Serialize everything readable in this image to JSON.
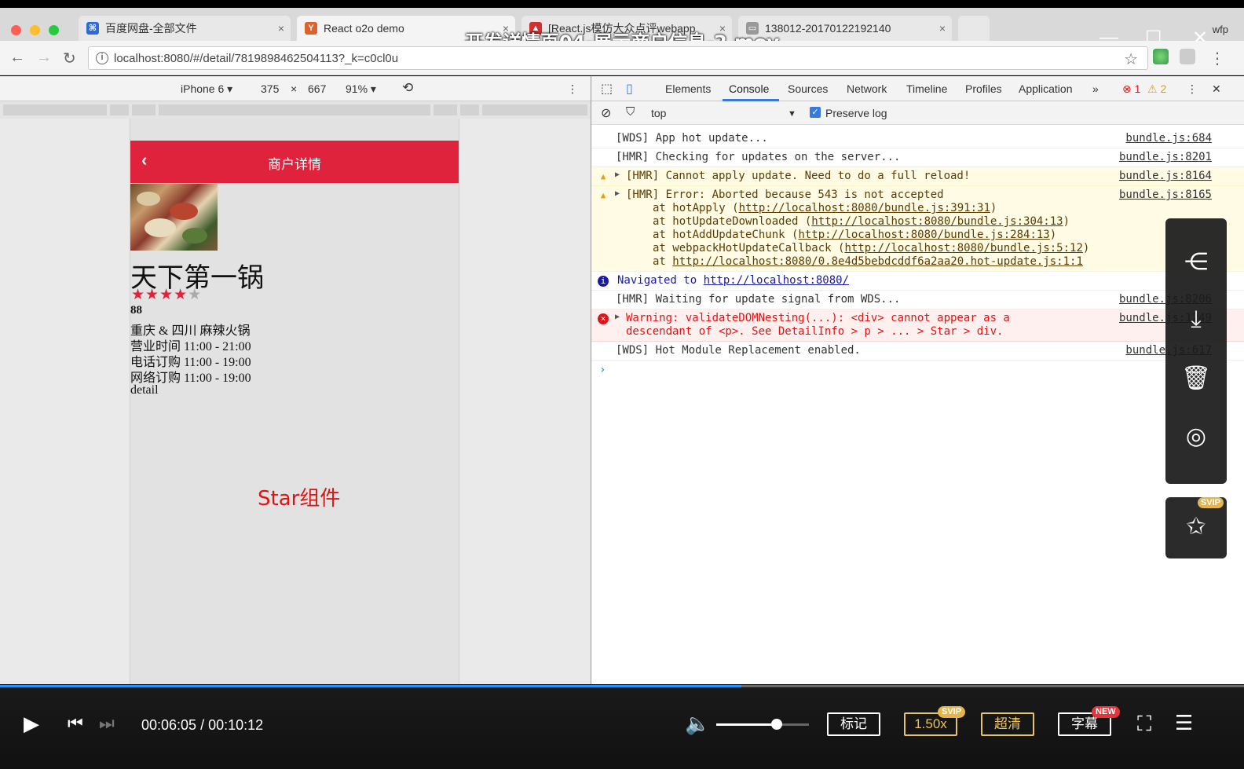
{
  "video_title": "开发详情页04-展示商户信息-2.mov",
  "browser": {
    "tabs": [
      {
        "label": "百度网盘-全部文件",
        "icon": "baidu-icon",
        "active": false
      },
      {
        "label": "React o2o demo",
        "icon": "ycombinator-icon",
        "active": true
      },
      {
        "label": "[React.js模仿大众点评webapp",
        "icon": "flame-icon",
        "active": false
      },
      {
        "label": "138012-20170122192140",
        "icon": "page-icon",
        "active": false
      }
    ],
    "user": "wfp",
    "url": "localhost:8080/#/detail/7819898462504113?_k=c0cl0u"
  },
  "device_toolbar": {
    "device": "iPhone 6",
    "width": "375",
    "times": "×",
    "height": "667",
    "zoom": "91%"
  },
  "phone": {
    "header_title": "商户详情",
    "back": "‹",
    "shop_name": "天下第一锅",
    "rating_stars": 4,
    "rating_max": 5,
    "score": "88",
    "lines": [
      "重庆 & 四川 麻辣火锅",
      "营业时间 11:00 - 21:00",
      "电话订购 11:00 - 19:00",
      "网络订购 11:00 - 19:00",
      "detail"
    ],
    "annotation": "Star组件"
  },
  "devtools": {
    "tabs": [
      "Elements",
      "Console",
      "Sources",
      "Network",
      "Timeline",
      "Profiles",
      "Application"
    ],
    "more": "»",
    "error_count": "1",
    "warning_count": "2",
    "filter_context": "top",
    "preserve_log": "Preserve log",
    "console": [
      {
        "text": "[WDS] App hot update...",
        "src": "bundle.js:684"
      },
      {
        "text": "[HMR] Checking for updates on the server...",
        "src": "bundle.js:8201"
      },
      {
        "text": "[HMR] Cannot apply update. Need to do a full reload!",
        "src": "bundle.js:8164"
      },
      {
        "text": "[HMR] Error: Aborted because 543 is not accepted",
        "src": "bundle.js:8165",
        "trace": [
          {
            "prefix": "at hotApply (",
            "link": "http://localhost:8080/bundle.js:391:31",
            "suffix": ")"
          },
          {
            "prefix": "at hotUpdateDownloaded (",
            "link": "http://localhost:8080/bundle.js:304:13",
            "suffix": ")"
          },
          {
            "prefix": "at hotAddUpdateChunk (",
            "link": "http://localhost:8080/bundle.js:284:13",
            "suffix": ")"
          },
          {
            "prefix": "at webpackHotUpdateCallback (",
            "link": "http://localhost:8080/bundle.js:5:12",
            "suffix": ")"
          },
          {
            "prefix": "at ",
            "link": "http://localhost:8080/0.8e4d5bebdcddf6a2aa20.hot-update.js:1:1",
            "suffix": ""
          }
        ]
      },
      {
        "text": "Navigated to",
        "link": "http://localhost:8080/"
      },
      {
        "text": "[HMR] Waiting for update signal from WDS...",
        "src": "bundle.js:8206"
      },
      {
        "text": "Warning: validateDOMNesting(...): <div> cannot appear as a",
        "text2": "descendant of <p>. See DetailInfo > p > ... > Star > div.",
        "src": "bundle.js:1249"
      },
      {
        "text": "[WDS] Hot Module Replacement enabled.",
        "src": "bundle.js:617"
      }
    ],
    "prompt": "›"
  },
  "player": {
    "current_time": "00:06:05",
    "separator": " / ",
    "total_time": "00:10:12",
    "progress": 0.596,
    "volume": 0.65,
    "buttons": {
      "mark": "标记",
      "speed": "1.50x",
      "speed_badge": "SVIP",
      "quality": "超清",
      "subtitle": "字幕",
      "subtitle_badge": "NEW"
    },
    "side_panel_badge": "SVIP"
  }
}
